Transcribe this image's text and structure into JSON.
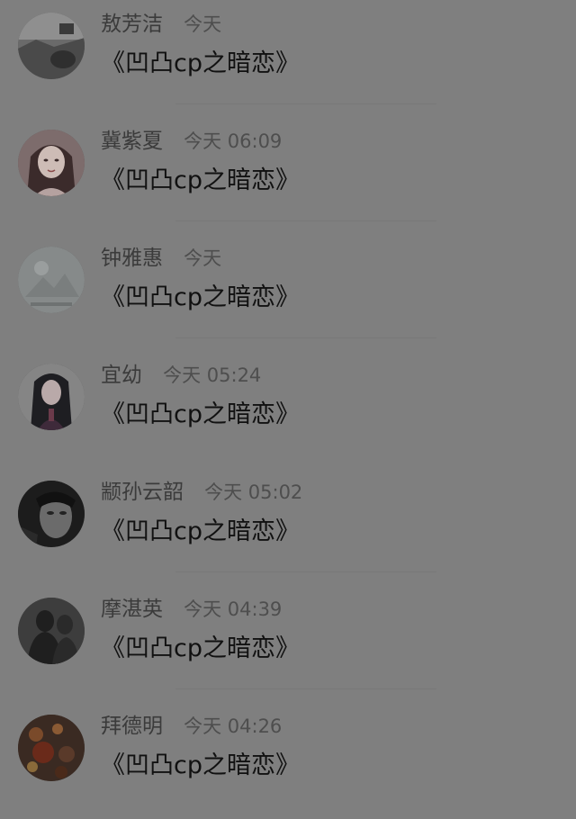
{
  "comments": [
    {
      "name": "敖芳洁",
      "time": "今天",
      "message": "《凹凸cp之暗恋》",
      "avatar": "landscape-avatar"
    },
    {
      "name": "冀紫夏",
      "time": "今天 06:09",
      "message": "《凹凸cp之暗恋》",
      "avatar": "girl-avatar"
    },
    {
      "name": "钟雅惠",
      "time": "今天",
      "message": "《凹凸cp之暗恋》",
      "avatar": "mountain-avatar"
    },
    {
      "name": "宜幼",
      "time": "今天 05:24",
      "message": "《凹凸cp之暗恋》",
      "avatar": "anime-avatar"
    },
    {
      "name": "颛孙云韶",
      "time": "今天 05:02",
      "message": "《凹凸cp之暗恋》",
      "avatar": "dark-man-avatar"
    },
    {
      "name": "摩湛英",
      "time": "今天 04:39",
      "message": "《凹凸cp之暗恋》",
      "avatar": "silhouette-avatar"
    },
    {
      "name": "拜德明",
      "time": "今天 04:26",
      "message": "《凹凸cp之暗恋》",
      "avatar": "bokeh-avatar"
    }
  ]
}
